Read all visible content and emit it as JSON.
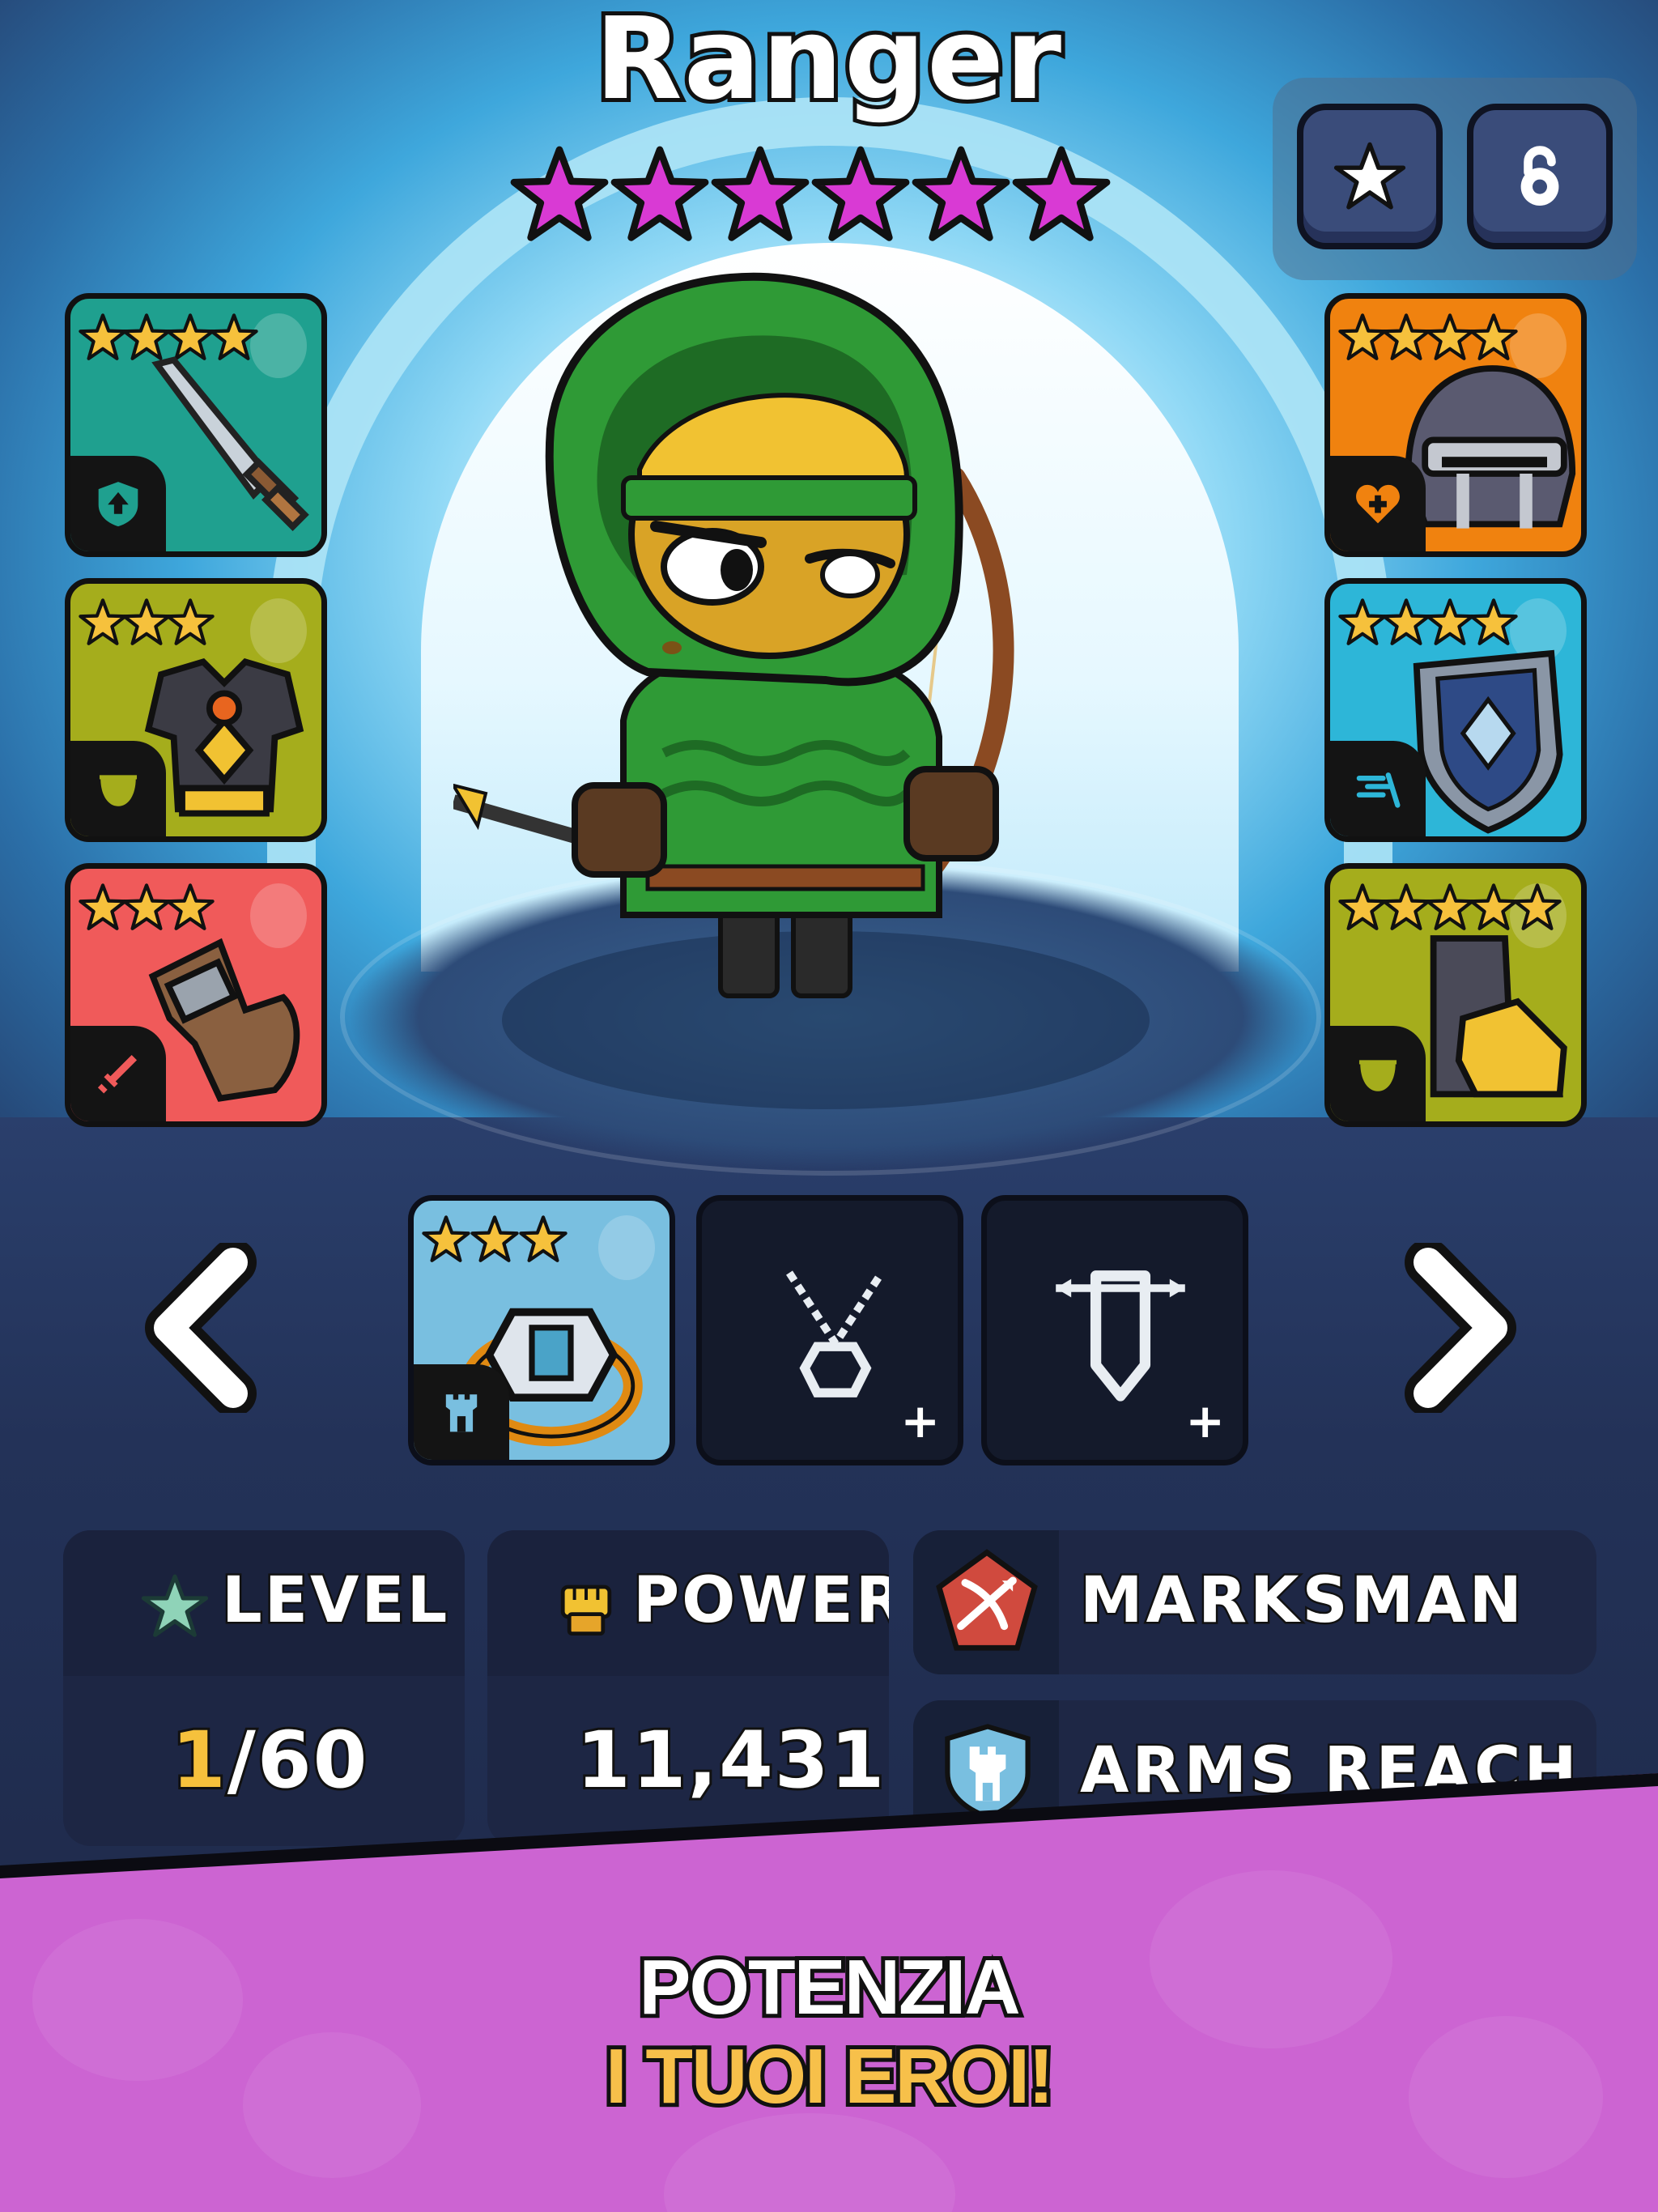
{
  "hero": {
    "name": "Ranger",
    "star_rating": 6
  },
  "corner_buttons": [
    {
      "icon": "star-icon"
    },
    {
      "icon": "unlock-icon"
    }
  ],
  "equipment_left": [
    {
      "item": "sword",
      "stars": 4,
      "color": "#1fa08f",
      "badge_icon": "shield-up-icon"
    },
    {
      "item": "armor",
      "stars": 3,
      "color": "#a5ad1c",
      "badge_icon": "cup-icon"
    },
    {
      "item": "gloves",
      "stars": 3,
      "color": "#f05a5a",
      "badge_icon": "sword-small-icon"
    }
  ],
  "equipment_right": [
    {
      "item": "helmet",
      "stars": 4,
      "color": "#f0820f",
      "badge_icon": "heart-plus-icon"
    },
    {
      "item": "shield",
      "stars": 4,
      "color": "#2db6d8",
      "badge_icon": "dodge-icon"
    },
    {
      "item": "boots",
      "stars": 5,
      "color": "#a5ad1c",
      "badge_icon": "cup-icon"
    }
  ],
  "accessory_slots": [
    {
      "item": "ring",
      "stars": 3,
      "filled": true,
      "color": "#79bfe0",
      "badge_icon": "tower-icon"
    },
    {
      "item": "amulet",
      "filled": false,
      "plus": "+"
    },
    {
      "item": "banner",
      "filled": false,
      "plus": "+"
    }
  ],
  "stats": {
    "level_label": "LEVEL",
    "level_current": "1",
    "level_max": "/60",
    "power_label": "POWER",
    "power_value": "11,431"
  },
  "traits": [
    {
      "label": "MARKSMAN",
      "icon": "bow-crossed-icon"
    },
    {
      "label": "ARMS REACH",
      "icon": "tower-shield-icon"
    }
  ],
  "promo": {
    "line1": "POTENZIA",
    "line2": "I TUOI EROI!"
  }
}
